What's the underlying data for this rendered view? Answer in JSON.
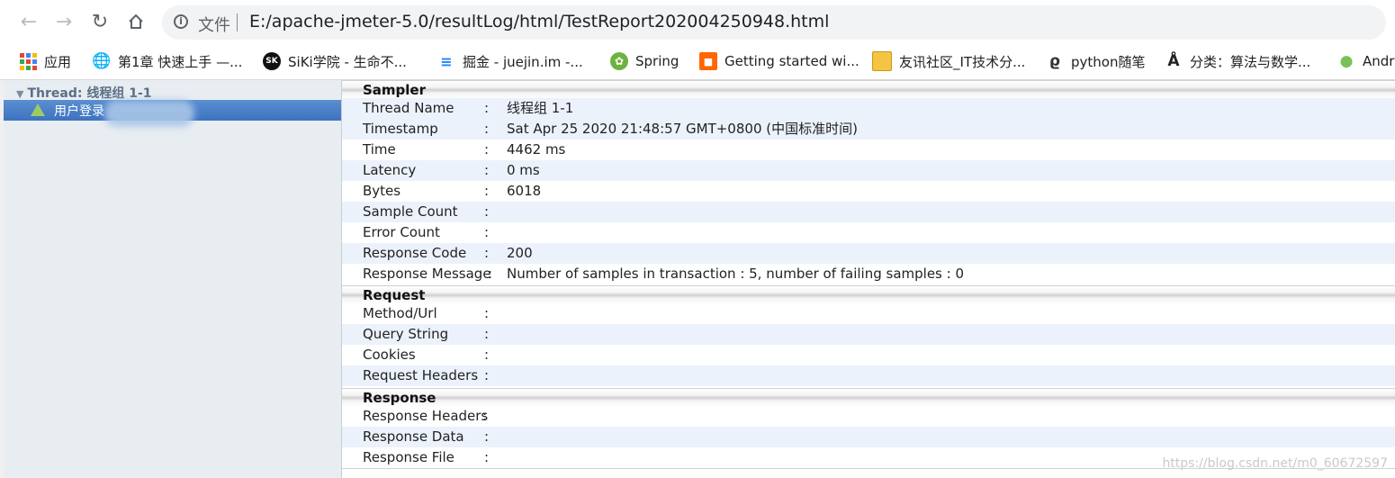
{
  "browser": {
    "scheme_label": "文件",
    "url": "E:/apache-jmeter-5.0/resultLog/html/TestReport202004250948.html"
  },
  "bookmarks": [
    {
      "label": "应用",
      "icon": "apps-grid-icon"
    },
    {
      "label": "第1章 快速上手 —...",
      "icon": "globe-icon"
    },
    {
      "label": "SiKi学院 - 生命不...",
      "icon": "siki-logo-icon"
    },
    {
      "label": "掘金 - juejin.im -...",
      "icon": "juejin-logo-icon"
    },
    {
      "label": "Spring",
      "icon": "spring-leaf-icon"
    },
    {
      "label": "Getting started wi...",
      "icon": "rabbitmq-logo-icon"
    },
    {
      "label": "友讯社区_IT技术分...",
      "icon": "note-icon"
    },
    {
      "label": "python随笔",
      "icon": "python-script-icon"
    },
    {
      "label": "分类：算法与数学...",
      "icon": "cnblogs-logo-icon"
    },
    {
      "label": "Andr",
      "icon": "android-icon"
    }
  ],
  "tree": {
    "root_label": "Thread: 线程组 1-1",
    "item_label": "用户登录"
  },
  "sampler": {
    "title": "Sampler",
    "rows": [
      {
        "key": "Thread Name",
        "value": "线程组 1-1"
      },
      {
        "key": "Timestamp",
        "value": "Sat Apr 25 2020 21:48:57 GMT+0800 (中国标准时间)"
      },
      {
        "key": "Time",
        "value": "4462 ms"
      },
      {
        "key": "Latency",
        "value": "0 ms"
      },
      {
        "key": "Bytes",
        "value": "6018"
      },
      {
        "key": "Sample Count",
        "value": ""
      },
      {
        "key": "Error Count",
        "value": ""
      },
      {
        "key": "Response Code",
        "value": "200"
      },
      {
        "key": "Response Message",
        "value": "Number of samples in transaction : 5, number of failing samples : 0"
      }
    ]
  },
  "request": {
    "title": "Request",
    "rows": [
      {
        "key": "Method/Url",
        "value": ""
      },
      {
        "key": "Query String",
        "value": ""
      },
      {
        "key": "Cookies",
        "value": ""
      },
      {
        "key": "Request Headers",
        "value": ""
      }
    ]
  },
  "response": {
    "title": "Response",
    "rows": [
      {
        "key": "Response Headers",
        "value": ""
      },
      {
        "key": "Response Data",
        "value": ""
      },
      {
        "key": "Response File",
        "value": ""
      }
    ]
  },
  "separator": ":",
  "watermark": "https://blog.csdn.net/m0_60672597",
  "colors": {
    "selected_row": "#3d72c0",
    "alt_row": "#ecf2fb",
    "tree_bg": "#e8edf2"
  }
}
